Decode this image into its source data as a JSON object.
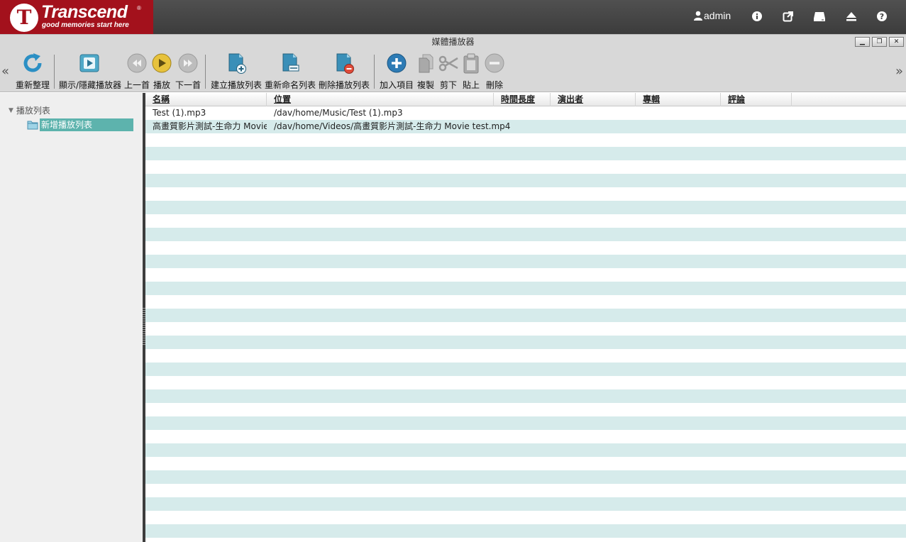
{
  "brand": {
    "logo_letter": "T",
    "name": "Transcend",
    "registered": "®",
    "tagline": "good memories start here"
  },
  "header": {
    "username": "admin",
    "icons": [
      "user-icon",
      "info-icon",
      "external-link-icon",
      "drive-icon",
      "eject-icon",
      "help-icon"
    ]
  },
  "window": {
    "title": "媒體播放器",
    "controls": {
      "minimize": "▁",
      "restore": "❐",
      "close": "✕"
    }
  },
  "toolbar": {
    "nav_left": "«",
    "nav_right": "»",
    "refresh": "重新整理",
    "toggle_player": "顯示/隱藏播放器",
    "previous": "上一首",
    "play": "播放",
    "next": "下一首",
    "create_playlist": "建立播放列表",
    "rename_playlist": "重新命名列表",
    "delete_playlist": "刪除播放列表",
    "add_item": "加入項目",
    "copy": "複製",
    "cut": "剪下",
    "paste": "貼上",
    "delete": "刪除"
  },
  "sidebar": {
    "root_label": "播放列表",
    "items": [
      {
        "label": "新增播放列表",
        "selected": true
      }
    ]
  },
  "grid": {
    "columns": [
      "名稱",
      "位置",
      "時間長度",
      "演出者",
      "專輯",
      "評論"
    ],
    "rows": [
      {
        "name": "Test (1).mp3",
        "location": "/dav/home/Music/Test (1).mp3",
        "duration": "",
        "artist": "",
        "album": "",
        "comment": ""
      },
      {
        "name": "高畫質影片測試-生命力 Movie",
        "location": "/dav/home/Videos/高畫質影片測試-生命力 Movie test.mp4",
        "duration": "",
        "artist": "",
        "album": "",
        "comment": ""
      }
    ]
  },
  "colors": {
    "brand_red": "#a3111c",
    "row_alt": "#d6ebeb",
    "selected": "#5db3ad",
    "accent_blue": "#2d7bb5",
    "play_yellow": "#e7c23c"
  }
}
